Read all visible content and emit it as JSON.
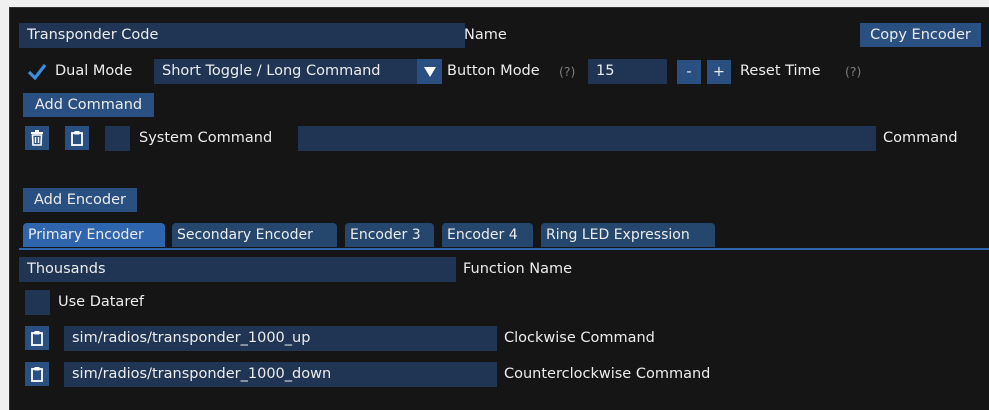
{
  "transponder": {
    "code_value": "Transponder Code",
    "name_label": "Name",
    "copy_encoder": "Copy Encoder"
  },
  "mode_row": {
    "dual_mode_label": "Dual Mode",
    "dual_mode_checked": true,
    "mode_select_value": "Short Toggle / Long Command",
    "button_mode_label": "Button Mode",
    "help": "(?)",
    "reset_value": "15",
    "minus": "-",
    "plus": "+",
    "reset_time_label": "Reset Time"
  },
  "commands": {
    "add_command": "Add Command",
    "system_command_label": "System Command",
    "command_value": "",
    "command_label": "Command"
  },
  "encoders": {
    "add_encoder": "Add Encoder",
    "tabs": [
      "Primary Encoder",
      "Secondary Encoder",
      "Encoder 3",
      "Encoder 4",
      "Ring LED Expression"
    ],
    "active_tab": "Primary Encoder"
  },
  "encoder_panel": {
    "function_value": "Thousands",
    "function_label": "Function Name",
    "use_dataref_label": "Use Dataref",
    "cw_value": "sim/radios/transponder_1000_up",
    "cw_label": "Clockwise Command",
    "ccw_value": "sim/radios/transponder_1000_down",
    "ccw_label": "Counterclockwise Command"
  },
  "colors": {
    "background": "#151515",
    "field": "#1f3553",
    "button": "#2a4f81",
    "tab_active": "#2e65ad",
    "check": "#3b8de0"
  },
  "icons": [
    "checkmark-icon",
    "dropdown-arrow-icon",
    "trash-icon",
    "clipboard-icon"
  ]
}
